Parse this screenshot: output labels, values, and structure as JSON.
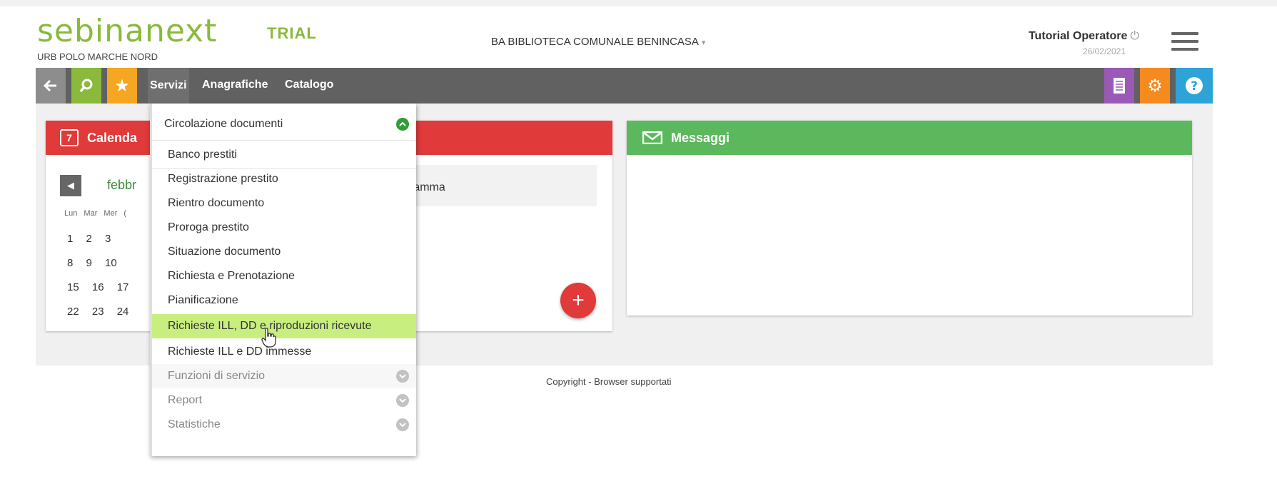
{
  "header": {
    "logo_part1": "sebina",
    "logo_part2": "next",
    "polo": "URB POLO MARCHE NORD",
    "edition": "TRIAL",
    "library": "BA BIBLIOTECA COMUNALE BENINCASA",
    "library_caret": "▾",
    "operator": "Tutorial Operatore",
    "date": "26/02/2021"
  },
  "navbar": {
    "back_icon": "arrow-left-icon",
    "search_icon": "search-icon",
    "star_icon": "star-icon",
    "links": [
      "Servizi",
      "Anagrafiche",
      "Catalogo"
    ],
    "active_link": "Servizi",
    "right_icons": [
      "document-icon",
      "gear-icon",
      "help-icon"
    ]
  },
  "calendar_panel": {
    "title": "Calenda",
    "icon_day": "7",
    "month": "febbr",
    "days_of_week": "Lun Mar Mer (",
    "rows": [
      "1 2 3",
      "8 9 10",
      "15 16 17",
      "22 23 24"
    ],
    "right_text": "ramma"
  },
  "messages_panel": {
    "title": "Messaggi"
  },
  "footer": {
    "text": "Copyright - Browser supportati"
  },
  "dropdown": {
    "section_title": "Circolazione documenti",
    "items": [
      "Banco prestiti",
      "Registrazione prestito",
      "Rientro documento",
      "Proroga prestito",
      "Situazione documento",
      "Richiesta e Prenotazione",
      "Pianificazione",
      "Richieste ILL, DD e riproduzioni ricevute",
      "Richieste ILL e DD immesse"
    ],
    "highlighted": "Richieste ILL, DD e riproduzioni ricevute",
    "collapsed_sections": [
      "Funzioni di servizio",
      "Report",
      "Statistiche"
    ]
  },
  "colors": {
    "brand_green": "#8ab93c",
    "navbar_bg": "#616161",
    "calendar_red": "#e03a3a",
    "messages_green": "#5cb85c",
    "highlight": "#c8ee80"
  }
}
